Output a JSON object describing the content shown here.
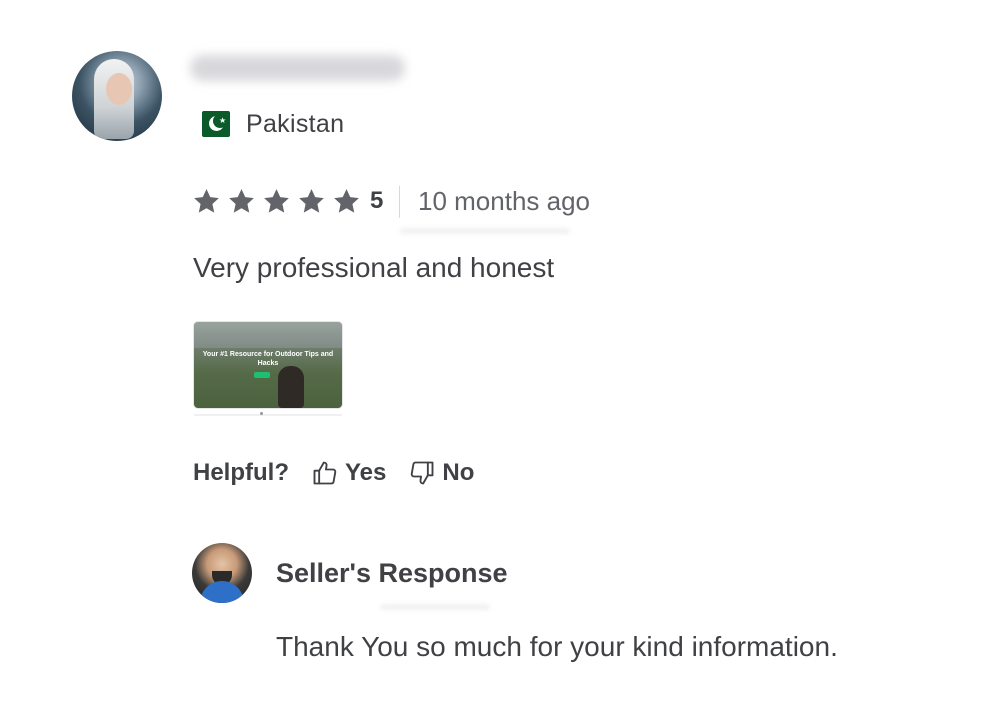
{
  "review": {
    "country": "Pakistan",
    "rating": "5",
    "time_ago": "10 months ago",
    "text": "Very professional and honest",
    "stars_filled": 5,
    "star_color": "#62646a",
    "image_caption": "Your #1 Resource for Outdoor Tips and Hacks"
  },
  "helpful": {
    "label": "Helpful?",
    "yes_label": "Yes",
    "no_label": "No"
  },
  "seller_response": {
    "title": "Seller's Response",
    "text": "Thank You so much for your kind information."
  },
  "colors": {
    "text": "#404145",
    "muted": "#62646a",
    "flag_green": "#0b5a2a"
  },
  "icons": {
    "thumbs_up": "thumbs-up-icon",
    "thumbs_down": "thumbs-down-icon",
    "star": "star-icon"
  }
}
